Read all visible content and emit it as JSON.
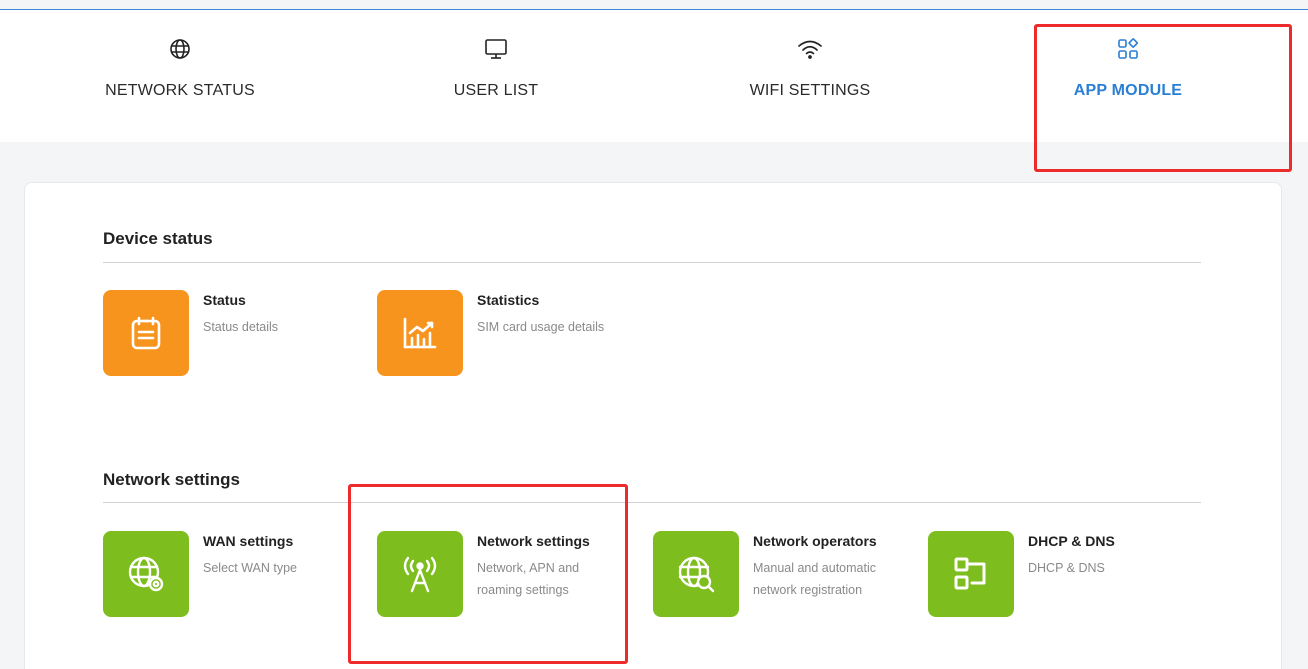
{
  "nav": {
    "items": [
      {
        "label": "NETWORK STATUS",
        "icon": "globe-icon"
      },
      {
        "label": "USER LIST",
        "icon": "monitor-icon"
      },
      {
        "label": "WIFI SETTINGS",
        "icon": "wifi-icon"
      },
      {
        "label": "APP MODULE",
        "icon": "app-grid-icon",
        "active": true
      }
    ],
    "active_color": "#2a7fd4"
  },
  "sections": [
    {
      "title": "Device status",
      "tiles": [
        {
          "title": "Status",
          "desc": "Status details",
          "icon": "clipboard-list-icon",
          "color": "#f7941d"
        },
        {
          "title": "Statistics",
          "desc": "SIM card usage details",
          "icon": "chart-bars-icon",
          "color": "#f7941d"
        }
      ]
    },
    {
      "title": "Network settings",
      "tiles": [
        {
          "title": "WAN settings",
          "desc": "Select WAN type",
          "icon": "globe-gear-icon",
          "color": "#7dbd1e"
        },
        {
          "title": "Network settings",
          "desc": "Network, APN and roaming settings",
          "icon": "antenna-icon",
          "color": "#7dbd1e"
        },
        {
          "title": "Network operators",
          "desc": "Manual and automatic network registration",
          "icon": "globe-search-icon",
          "color": "#7dbd1e"
        },
        {
          "title": "DHCP & DNS",
          "desc": "DHCP & DNS",
          "icon": "dhcp-blocks-icon",
          "color": "#7dbd1e"
        }
      ]
    }
  ],
  "highlight_color": "#ee2b2b"
}
